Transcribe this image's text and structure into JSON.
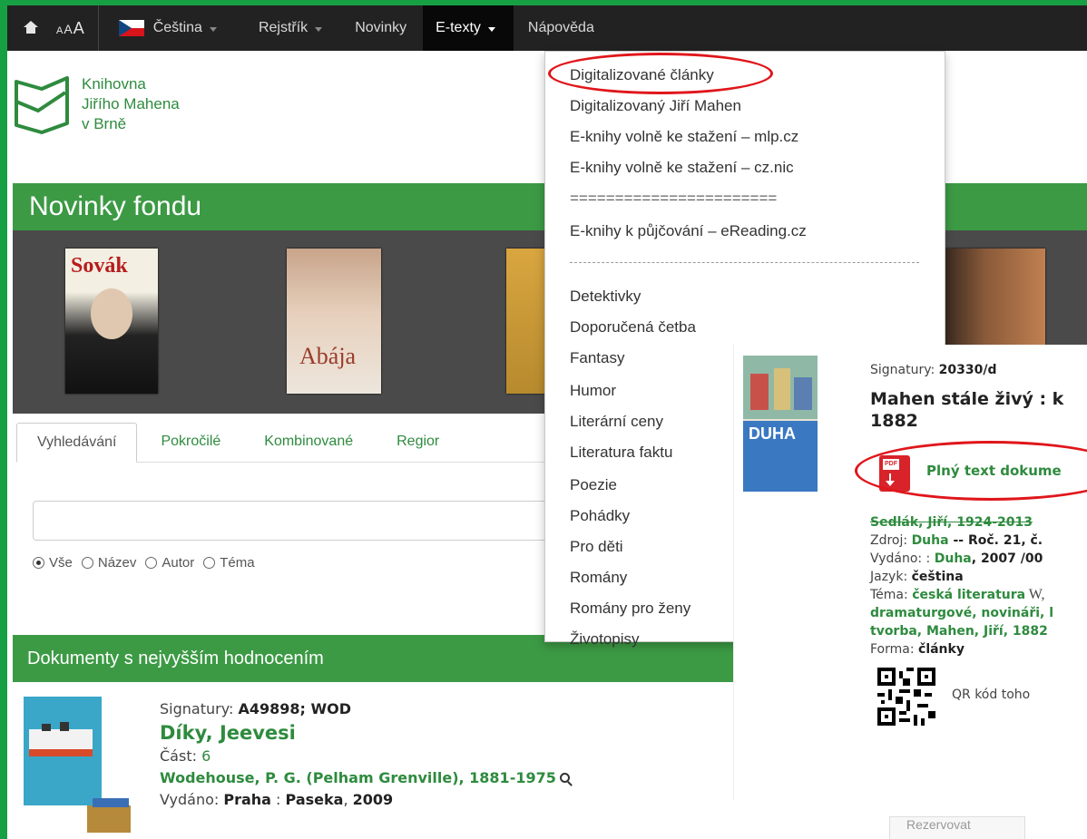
{
  "navbar": {
    "font_size_label": "AAA",
    "language": "Čeština",
    "items": [
      "Rejstřík",
      "Novinky",
      "E-texty",
      "Nápověda"
    ]
  },
  "logo": {
    "line1": "Knihovna",
    "line2": "Jiřího Mahena",
    "line3": "v Brně"
  },
  "novinky_fondu": {
    "title": "Novinky fondu",
    "covers": [
      "Sovák",
      "Abája"
    ]
  },
  "search": {
    "tabs": [
      "Vyhledávání",
      "Pokročilé",
      "Kombinované",
      "Regior"
    ],
    "input_value": "",
    "radios": [
      "Vše",
      "Název",
      "Autor",
      "Téma"
    ],
    "selected_radio": "Vše"
  },
  "dokumenty": {
    "title": "Dokumenty s nejvyšším hodnocením",
    "item": {
      "signatury_label": "Signatury:",
      "signatury": "A49898; WOD",
      "title": "Díky, Jeevesi",
      "cast_label": "Část:",
      "cast": "6",
      "author": "Wodehouse, P. G. (Pelham Grenville), 1881-1975",
      "vydano_label": "Vydáno:",
      "vydano_place": "Praha",
      "vydano_sep": " : ",
      "vydano_publisher": "Paseka",
      "vydano_year": "2009"
    },
    "reserve": "Rezervovat"
  },
  "dropdown": {
    "items": [
      "Digitalizované články",
      "Digitalizovaný Jiří Mahen",
      "E-knihy volně ke stažení – mlp.cz",
      "E-knihy volně ke stažení – cz.nic",
      "=======================",
      "E-knihy k půjčování – eReading.cz",
      "Detektivky",
      "Doporučená četba",
      "Fantasy",
      "Humor",
      "Literární ceny",
      "Literatura faktu",
      "Poezie",
      "Pohádky",
      "Pro děti",
      "Romány",
      "Romány pro ženy",
      "Životopisy"
    ]
  },
  "card": {
    "cover_label": "DUHA",
    "signatury_label": "Signatury:",
    "signatury": "20330/d",
    "title_line1": "Mahen stále živý : k",
    "title_line2": "1882",
    "pdf_badge": "PDF",
    "pdf_link": "Plný text dokume",
    "author": "Sedlák, Jiří, 1924-2013",
    "zdroj_label": "Zdroj:",
    "zdroj": "Duha",
    "zdroj_rest": " -- Roč. 21, č.",
    "vydano_label": "Vydáno: :",
    "vydano": "Duha",
    "vydano_rest": ", 2007 /00",
    "jazyk_label": "Jazyk:",
    "jazyk": "čeština",
    "tema_label": "Téma:",
    "tema1": "česká literatura",
    "tema1_extra": " W,",
    "tema2": "dramaturgové, novináři, l",
    "tema3": "tvorba, Mahen, Jiří, 1882",
    "forma_label": "Forma:",
    "forma": "články",
    "qr_label": "QR kód toho"
  }
}
